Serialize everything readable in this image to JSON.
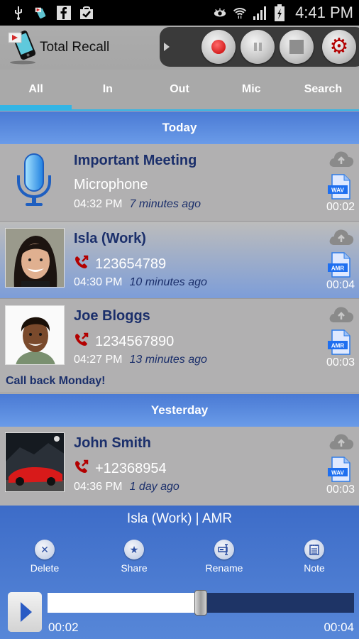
{
  "status_bar": {
    "left_icons": [
      "usb-icon",
      "recorder-notification-icon",
      "facebook-icon",
      "shopping-bag-check-icon"
    ],
    "right_icons": [
      "eye-icon",
      "wifi-icon",
      "signal-icon",
      "battery-charging-icon"
    ],
    "time": "4:41 PM"
  },
  "header": {
    "app_title": "Total Recall",
    "controls": [
      "record",
      "pause",
      "stop",
      "settings"
    ]
  },
  "tabs": [
    {
      "label": "All",
      "active": true
    },
    {
      "label": "In",
      "active": false
    },
    {
      "label": "Out",
      "active": false
    },
    {
      "label": "Mic",
      "active": false
    },
    {
      "label": "Search",
      "active": false
    }
  ],
  "sections": [
    {
      "title": "Today",
      "items": [
        {
          "name": "Important Meeting",
          "source": "Microphone",
          "number": "",
          "time": "04:32 PM",
          "ago": "7 minutes ago",
          "format": "WAV",
          "duration": "00:02",
          "note": "",
          "avatar": "microphone",
          "selected": false
        },
        {
          "name": "Isla (Work)",
          "source": "",
          "number": "123654789",
          "time": "04:30 PM",
          "ago": "10 minutes ago",
          "format": "AMR",
          "duration": "00:04",
          "note": "",
          "avatar": "photo-woman",
          "selected": true
        },
        {
          "name": "Joe Bloggs",
          "source": "",
          "number": "1234567890",
          "time": "04:27 PM",
          "ago": "13 minutes ago",
          "format": "AMR",
          "duration": "00:03",
          "note": "Call back Monday!",
          "avatar": "photo-man",
          "selected": false
        }
      ]
    },
    {
      "title": "Yesterday",
      "items": [
        {
          "name": "John Smith",
          "source": "",
          "number": "+12368954",
          "time": "04:36 PM",
          "ago": "1 day ago",
          "format": "WAV",
          "duration": "00:03",
          "note": "",
          "avatar": "photo-red-car",
          "selected": false
        }
      ]
    }
  ],
  "player": {
    "title": "Isla (Work) | AMR",
    "actions": [
      {
        "label": "Delete",
        "icon": "x-icon"
      },
      {
        "label": "Share",
        "icon": "star-icon"
      },
      {
        "label": "Rename",
        "icon": "rename-icon"
      },
      {
        "label": "Note",
        "icon": "notepad-icon"
      }
    ],
    "current_time": "00:02",
    "total_time": "00:04",
    "progress": 0.5
  },
  "colors": {
    "accent_tab": "#33b5e5",
    "section_header": "#4a7ad4",
    "name_text": "#1b2f6b",
    "call_icon": "#b30000",
    "record_red": "#c40000",
    "player_bg": "#3d6cc8"
  }
}
